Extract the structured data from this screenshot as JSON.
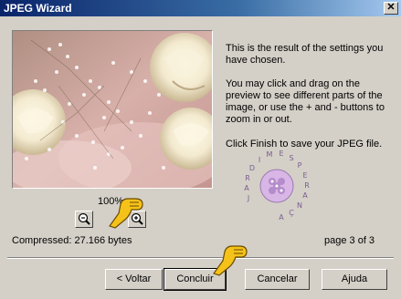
{
  "window": {
    "title": "JPEG Wizard"
  },
  "description": {
    "line1": "This is the result of the settings you have chosen.",
    "line2": "You may click and drag on the preview to see different parts of the image, or use the + and - buttons to zoom in or out.",
    "line3": "Click Finish to save your JPEG file."
  },
  "watermark_text": "JARDIM ESPERANÇA",
  "zoom": {
    "level": "100%"
  },
  "status": {
    "compressed": "Compressed: 27.166 bytes",
    "page": "page 3 of 3"
  },
  "buttons": {
    "back": "< Voltar",
    "finish": "Concluir",
    "cancel": "Cancelar",
    "help": "Ajuda"
  },
  "icons": [
    "close-icon",
    "zoom-out-icon",
    "zoom-in-icon",
    "hand-cursor-icon"
  ]
}
